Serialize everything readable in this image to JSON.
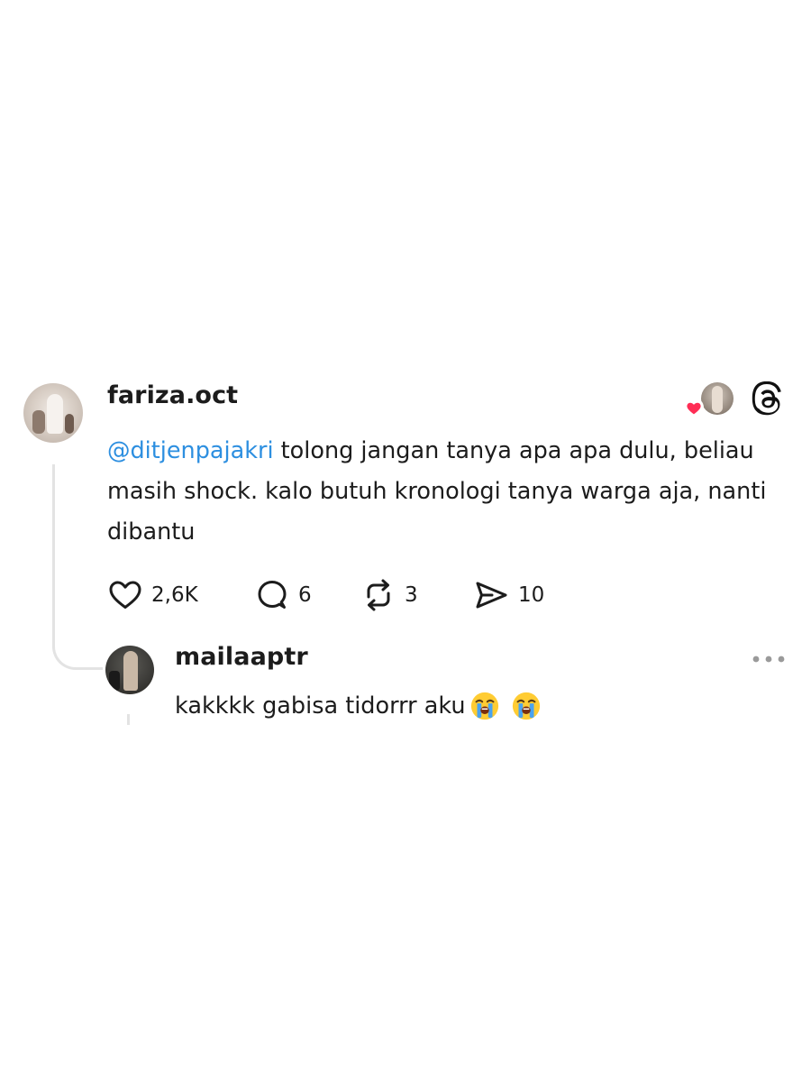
{
  "post": {
    "username": "fariza.oct",
    "mention": "@ditjenpajakri",
    "text_rest": " tolong jangan tanya apa apa dulu, beliau masih shock. kalo butuh kronologi tanya warga aja, nanti dibantu",
    "stats": {
      "likes": "2,6K",
      "replies": "6",
      "reposts": "3",
      "shares": "10"
    }
  },
  "reply": {
    "username": "mailaaptr",
    "text": "kakkkk gabisa tidorrr aku",
    "emojis": [
      "loudly-crying-face",
      "loudly-crying-face"
    ]
  },
  "colors": {
    "mention": "#2d8fe0",
    "heart_badge": "#ff2d55",
    "thread_line": "#e3e3e3",
    "text": "#1c1c1c"
  },
  "icons": [
    "heart-icon",
    "comment-icon",
    "repost-icon",
    "share-icon",
    "threads-logo-icon",
    "more-icon"
  ]
}
